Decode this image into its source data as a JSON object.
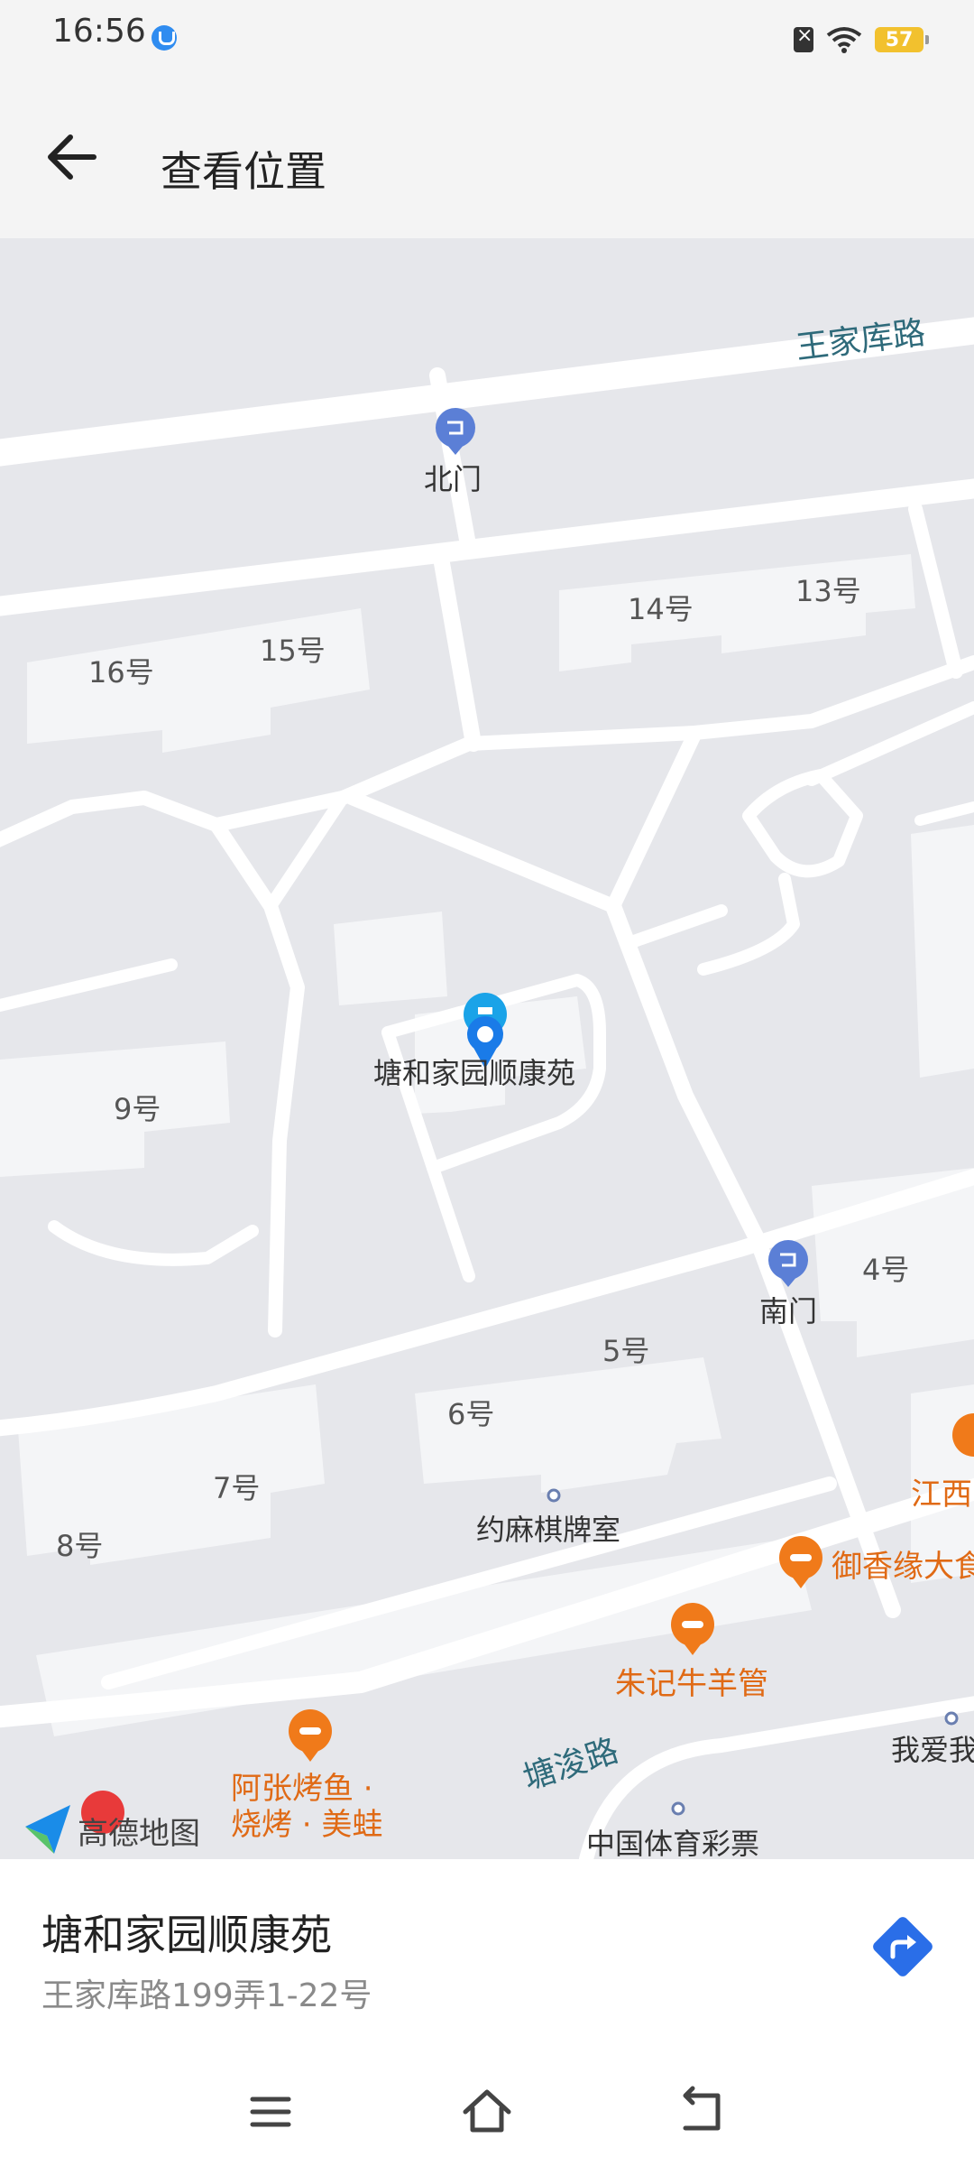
{
  "status_bar": {
    "time": "16:56",
    "battery": "57"
  },
  "app_bar": {
    "title": "查看位置"
  },
  "map": {
    "roads": {
      "north": "王家库路",
      "south": "塘浚路"
    },
    "gates": {
      "north_gate": "北门",
      "south_gate": "南门"
    },
    "buildings": [
      "16号",
      "15号",
      "14号",
      "13号",
      "9号",
      "4号",
      "5号",
      "6号",
      "7号",
      "8号"
    ],
    "selected_place_label": "塘和家园顺康苑",
    "pois": {
      "chess_room": "约麻棋牌室",
      "yuxiangyuan": "御香缘大食",
      "zhuji": "朱记牛羊管",
      "jiangxi": "江西",
      "azhang_line1": "阿张烤鱼 ·",
      "azhang_line2": "烧烤 · 美蛙",
      "lottery": "中国体育彩票",
      "woaiwo": "我爱我"
    },
    "logo_text": "高德地图"
  },
  "place": {
    "name": "塘和家园顺康苑",
    "address": "王家库路199弄1-22号"
  },
  "colors": {
    "map_bg": "#e6e7eb",
    "road": "#ffffff",
    "building": "#f4f5f7",
    "gate_pin": "#5b7fd6",
    "selected_pin": "#1aa3e8",
    "poi_orange": "#f07a1a",
    "route_blue": "#2a6ee8"
  }
}
